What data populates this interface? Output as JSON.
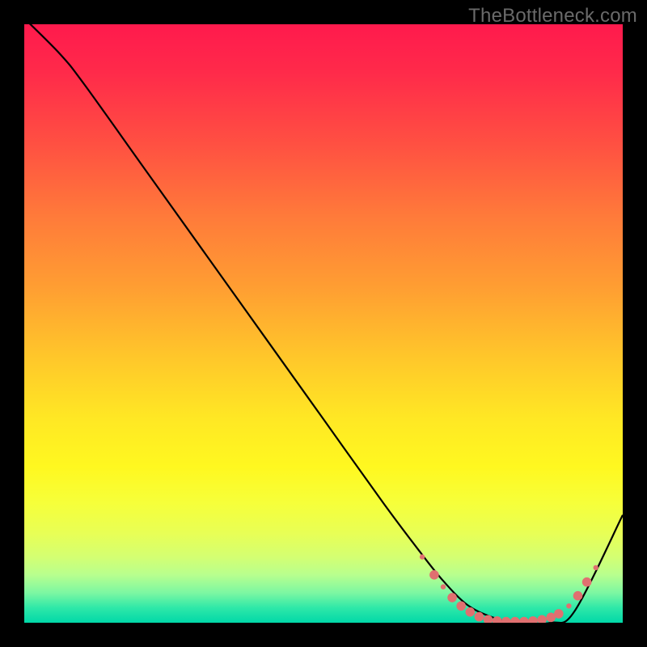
{
  "watermark": "TheBottleneck.com",
  "chart_data": {
    "type": "line",
    "title": "",
    "xlabel": "",
    "ylabel": "",
    "xlim": [
      0,
      100
    ],
    "ylim": [
      0,
      100
    ],
    "grid": false,
    "legend": false,
    "series": [
      {
        "name": "curve",
        "color": "#000000",
        "x": [
          0,
          6,
          10,
          20,
          30,
          40,
          50,
          60,
          66,
          70,
          74,
          78,
          82,
          88,
          92,
          100
        ],
        "y": [
          101,
          95,
          90,
          76,
          62,
          48,
          34,
          20,
          12,
          7,
          3,
          1,
          0,
          0,
          2,
          18
        ]
      }
    ],
    "markers": {
      "color": "#e07070",
      "radius_small": 3.2,
      "radius_large": 5.8,
      "points": [
        {
          "x": 66.5,
          "y": 11.0,
          "r": "small"
        },
        {
          "x": 68.5,
          "y": 8.0,
          "r": "large"
        },
        {
          "x": 70.0,
          "y": 6.0,
          "r": "small"
        },
        {
          "x": 71.5,
          "y": 4.2,
          "r": "large"
        },
        {
          "x": 73.0,
          "y": 2.8,
          "r": "large"
        },
        {
          "x": 74.5,
          "y": 1.8,
          "r": "large"
        },
        {
          "x": 76.0,
          "y": 1.0,
          "r": "large"
        },
        {
          "x": 77.5,
          "y": 0.5,
          "r": "large"
        },
        {
          "x": 79.0,
          "y": 0.3,
          "r": "large"
        },
        {
          "x": 80.5,
          "y": 0.2,
          "r": "large"
        },
        {
          "x": 82.0,
          "y": 0.2,
          "r": "large"
        },
        {
          "x": 83.5,
          "y": 0.2,
          "r": "large"
        },
        {
          "x": 85.0,
          "y": 0.3,
          "r": "large"
        },
        {
          "x": 86.5,
          "y": 0.5,
          "r": "large"
        },
        {
          "x": 88.0,
          "y": 0.9,
          "r": "large"
        },
        {
          "x": 89.3,
          "y": 1.5,
          "r": "large"
        },
        {
          "x": 91.0,
          "y": 2.8,
          "r": "small"
        },
        {
          "x": 92.5,
          "y": 4.5,
          "r": "large"
        },
        {
          "x": 94.0,
          "y": 6.8,
          "r": "large"
        },
        {
          "x": 95.5,
          "y": 9.2,
          "r": "small"
        }
      ]
    }
  }
}
